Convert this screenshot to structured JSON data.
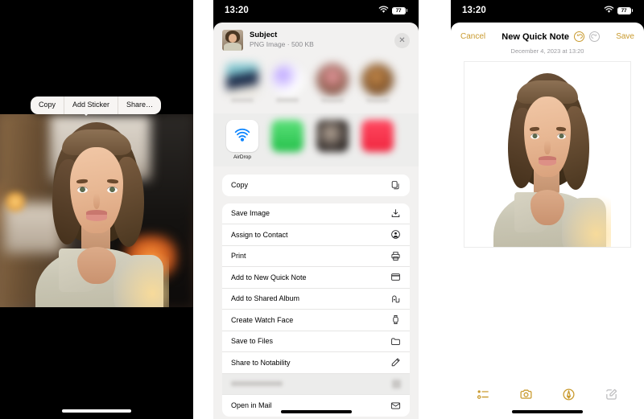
{
  "colors": {
    "accent_gold": "#C99A2E",
    "sheet_bg": "#F2F1F0",
    "card_bg": "#FFFFFF",
    "muted_text": "#8A8A8E",
    "dim_icon": "#BDBDBF"
  },
  "panel1": {
    "name": "photo-subject-lift",
    "context_menu": {
      "items": [
        {
          "label": "Copy",
          "name": "copy"
        },
        {
          "label": "Add Sticker",
          "name": "add-sticker"
        },
        {
          "label": "Share…",
          "name": "share"
        }
      ]
    }
  },
  "panel2": {
    "status_bar": {
      "time": "13:20",
      "battery_level": "77",
      "wifi_icon": "wifi-icon",
      "battery_icon": "battery-icon"
    },
    "share_sheet": {
      "file_title": "Subject",
      "file_meta": "PNG Image · 500 KB",
      "close_icon": "close-icon",
      "thumbnail": "subject-thumbnail",
      "suggestions": [
        {
          "name": "suggestion-1"
        },
        {
          "name": "suggestion-2"
        },
        {
          "name": "suggestion-3"
        },
        {
          "name": "suggestion-4"
        }
      ],
      "apps": [
        {
          "label": "AirDrop",
          "name": "airdrop",
          "icon": "airdrop-icon"
        },
        {
          "label": "",
          "name": "app-green",
          "icon": "app-icon-blurred"
        },
        {
          "label": "",
          "name": "app-dark",
          "icon": "app-icon-blurred"
        },
        {
          "label": "",
          "name": "app-red",
          "icon": "app-icon-blurred"
        }
      ],
      "actions_primary": [
        {
          "label": "Copy",
          "name": "copy",
          "icon": "copy-icon"
        }
      ],
      "actions": [
        {
          "label": "Save Image",
          "name": "save-image",
          "icon": "download-icon"
        },
        {
          "label": "Assign to Contact",
          "name": "assign-to-contact",
          "icon": "contact-icon"
        },
        {
          "label": "Print",
          "name": "print",
          "icon": "printer-icon"
        },
        {
          "label": "Add to New Quick Note",
          "name": "add-to-new-quick-note",
          "icon": "quick-note-icon"
        },
        {
          "label": "Add to Shared Album",
          "name": "add-to-shared-album",
          "icon": "shared-album-icon"
        },
        {
          "label": "Create Watch Face",
          "name": "create-watch-face",
          "icon": "watch-icon"
        },
        {
          "label": "Save to Files",
          "name": "save-to-files",
          "icon": "folder-icon"
        },
        {
          "label": "Share to Notability",
          "name": "share-to-notability",
          "icon": "pencil-icon"
        },
        {
          "label": "",
          "name": "blurred-action",
          "icon": "blurred-icon"
        },
        {
          "label": "Open in Mail",
          "name": "open-in-mail",
          "icon": "mail-icon"
        }
      ]
    }
  },
  "panel3": {
    "status_bar": {
      "time": "13:20",
      "battery_level": "77",
      "wifi_icon": "wifi-icon",
      "battery_icon": "battery-icon"
    },
    "note": {
      "cancel_label": "Cancel",
      "title": "New Quick Note",
      "save_label": "Save",
      "undo_icon": "undo-icon",
      "redo_icon": "redo-icon",
      "date": "December 4, 2023 at 13:20",
      "attached_image": "subject-cutout-image",
      "toolbar": [
        {
          "name": "checklist",
          "icon": "checklist-icon",
          "enabled": true
        },
        {
          "name": "camera",
          "icon": "camera-icon",
          "enabled": true
        },
        {
          "name": "markup",
          "icon": "markup-pen-icon",
          "enabled": true
        },
        {
          "name": "compose",
          "icon": "compose-icon",
          "enabled": false
        }
      ]
    }
  }
}
